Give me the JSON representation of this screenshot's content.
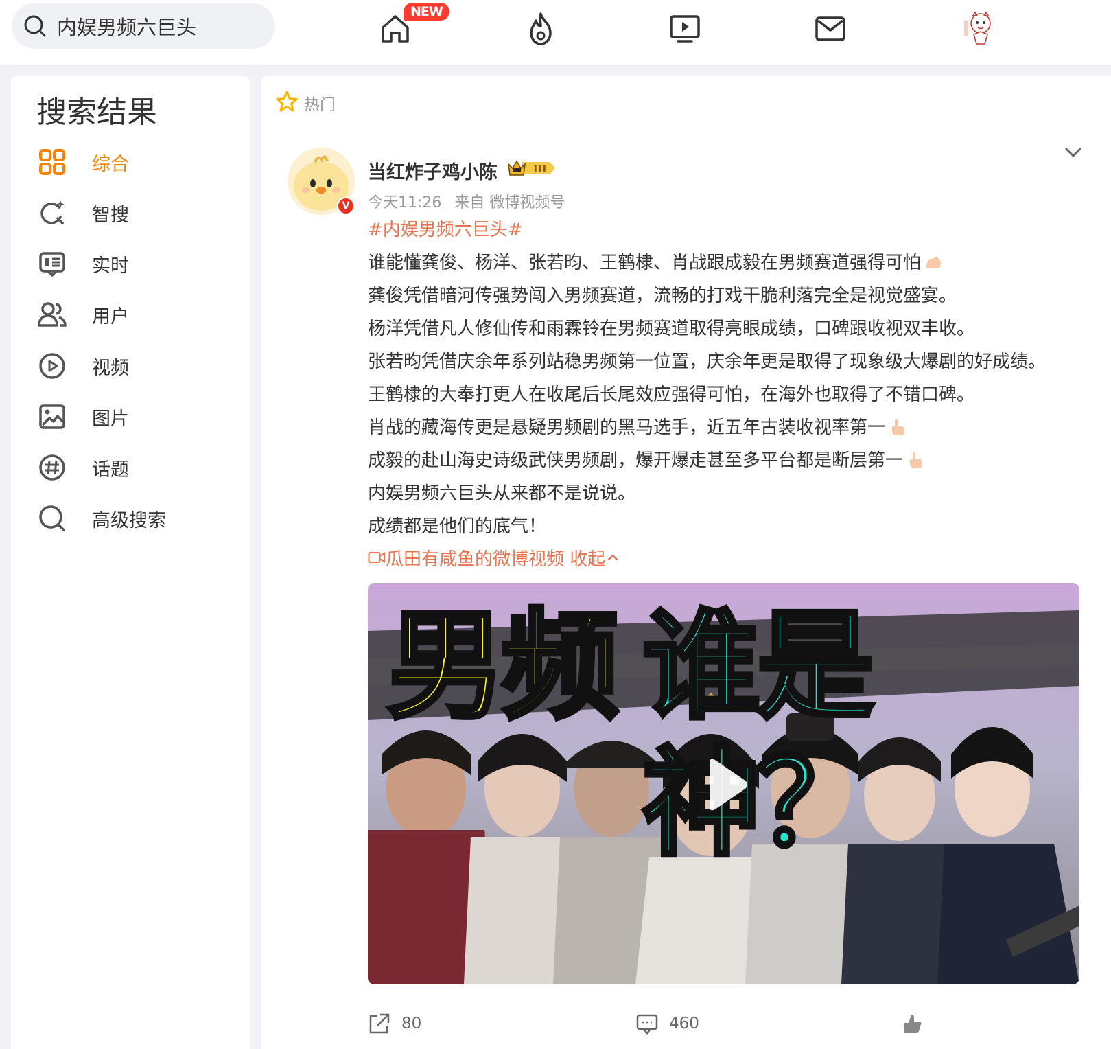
{
  "search": {
    "query": "内娱男频六巨头"
  },
  "topnav": {
    "new_badge": "NEW",
    "items": [
      "home-icon",
      "hot-icon",
      "video-icon",
      "message-icon",
      "avatar"
    ]
  },
  "sidebar": {
    "title": "搜索结果",
    "items": [
      {
        "label": "综合",
        "icon": "grid-icon",
        "active": true
      },
      {
        "label": "智搜",
        "icon": "smart-search-icon"
      },
      {
        "label": "实时",
        "icon": "realtime-icon"
      },
      {
        "label": "用户",
        "icon": "users-icon"
      },
      {
        "label": "视频",
        "icon": "video-play-icon"
      },
      {
        "label": "图片",
        "icon": "image-icon"
      },
      {
        "label": "话题",
        "icon": "topic-icon"
      },
      {
        "label": "高级搜索",
        "icon": "advanced-search-icon"
      }
    ]
  },
  "post": {
    "hot_label": "热门",
    "username": "当红炸子鸡小陈",
    "verified_mark": "V",
    "time": "今天11:26",
    "source": "来自 微博视频号",
    "hashtag": "#内娱男频六巨头#",
    "lines": [
      "谁能懂龚俊、杨洋、张若昀、王鹤棣、肖战跟成毅在男频赛道强得可怕",
      "龚俊凭借暗河传强势闯入男频赛道，流畅的打戏干脆利落完全是视觉盛宴。",
      "杨洋凭借凡人修仙传和雨霖铃在男频赛道取得亮眼成绩，口碑跟收视双丰收。",
      "张若昀凭借庆余年系列站稳男频第一位置，庆余年更是取得了现象级大爆剧的好成绩。",
      "王鹤棣的大奉打更人在收尾后长尾效应强得可怕，在海外也取得了不错口碑。",
      "肖战的藏海传更是悬疑男频剧的黑马选手，近五年古装收视率第一",
      "成毅的赴山海史诗级武侠男频剧，爆开爆走甚至多平台都是断层第一",
      "内娱男频六巨头从来都不是说说。",
      "成绩都是他们的底气！"
    ],
    "video_link": "瓜田有咸鱼的微博视频",
    "collapse_label": "收起",
    "thumbnail": {
      "text_yellow": "男频",
      "text_cyan": "谁是神？"
    },
    "actions": {
      "repost_count": "80",
      "comment_count": "460"
    }
  }
}
